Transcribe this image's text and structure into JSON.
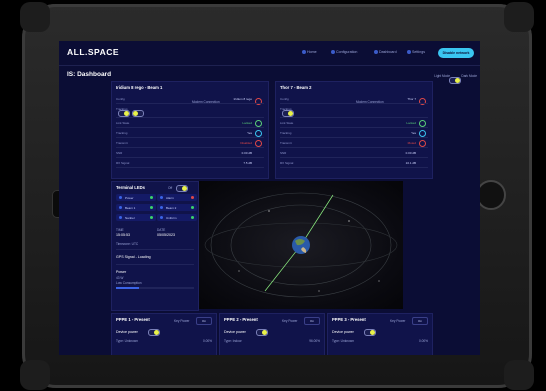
{
  "app": {
    "logo": "ALL.SPACE"
  },
  "nav": {
    "items": [
      "Home",
      "Configuration",
      "Dashboard",
      "Settings"
    ]
  },
  "header_button": "Disable network",
  "page_title": "IS: Dashboard",
  "mode_toggle": {
    "left": "Light Mode",
    "right": "Dark Mode"
  },
  "beam_panels": [
    {
      "title": "Iridium 8 rego - Beam 1",
      "status": "Modem Connection",
      "rows": [
        {
          "k": "Config",
          "v": "Iridium 8 rego"
        },
        {
          "k": "Tracking",
          "v": ""
        },
        {
          "k": "Link State",
          "v": "Locked"
        },
        {
          "k": "Tracking",
          "v": "Yes"
        },
        {
          "k": "Transmit",
          "v": "Disabled"
        },
        {
          "k": "SNR",
          "v": "0.00 dB"
        },
        {
          "k": "RX Signal",
          "v": "7.5 dB"
        }
      ]
    },
    {
      "title": "Thor 7 - Beam 2",
      "status": "Modem Connection",
      "rows": [
        {
          "k": "Config",
          "v": "Thor 7"
        },
        {
          "k": "Tracking",
          "v": ""
        },
        {
          "k": "Link State",
          "v": "Locked"
        },
        {
          "k": "Tracking",
          "v": "Yes"
        },
        {
          "k": "Transmit",
          "v": "Muted"
        },
        {
          "k": "SNR",
          "v": "0.00 dB"
        },
        {
          "k": "RX Signal",
          "v": "10.1 dB"
        }
      ]
    }
  ],
  "terminal": {
    "title": "Terminal LEDs",
    "toggle_label": "Off",
    "leds": [
      {
        "label": "Power",
        "color": "#39d26a"
      },
      {
        "label": "Alarm",
        "color": "#e04848"
      },
      {
        "label": "Beam 1",
        "color": "#39d26a"
      },
      {
        "label": "Beam 2",
        "color": "#39d26a"
      },
      {
        "label": "Nanbel",
        "color": "#39d26a"
      },
      {
        "label": "Uniform",
        "color": "#39d26a"
      }
    ],
    "time_label": "TIME",
    "time": "15:05:53",
    "date_label": "DATE",
    "date": "05/05/2023",
    "timezone": "Timezone: UTC",
    "gps": "GPS Signal - Loading",
    "power_title": "Power",
    "power_value": "43 W",
    "power_sub": "Low Consumption"
  },
  "presets": [
    {
      "title": "PPPE 1 - Present",
      "key_label": "Key Power",
      "select": "On",
      "device": "Device power",
      "type": "Type: Unknown",
      "value": "0.00%"
    },
    {
      "title": "PPPE 2 - Present",
      "key_label": "Key Power",
      "select": "On",
      "device": "Device power",
      "type": "Type: Indoor",
      "value": "96.00%"
    },
    {
      "title": "PPPE 3 - Present",
      "key_label": "Key Power",
      "select": "On",
      "device": "Device power",
      "type": "Type: Unknown",
      "value": "0.00%"
    }
  ],
  "colors": {
    "accent": "#3ac6f2",
    "toggle_on": "#e9f24a",
    "bg": "#0b0d35",
    "panel": "#10134a"
  }
}
